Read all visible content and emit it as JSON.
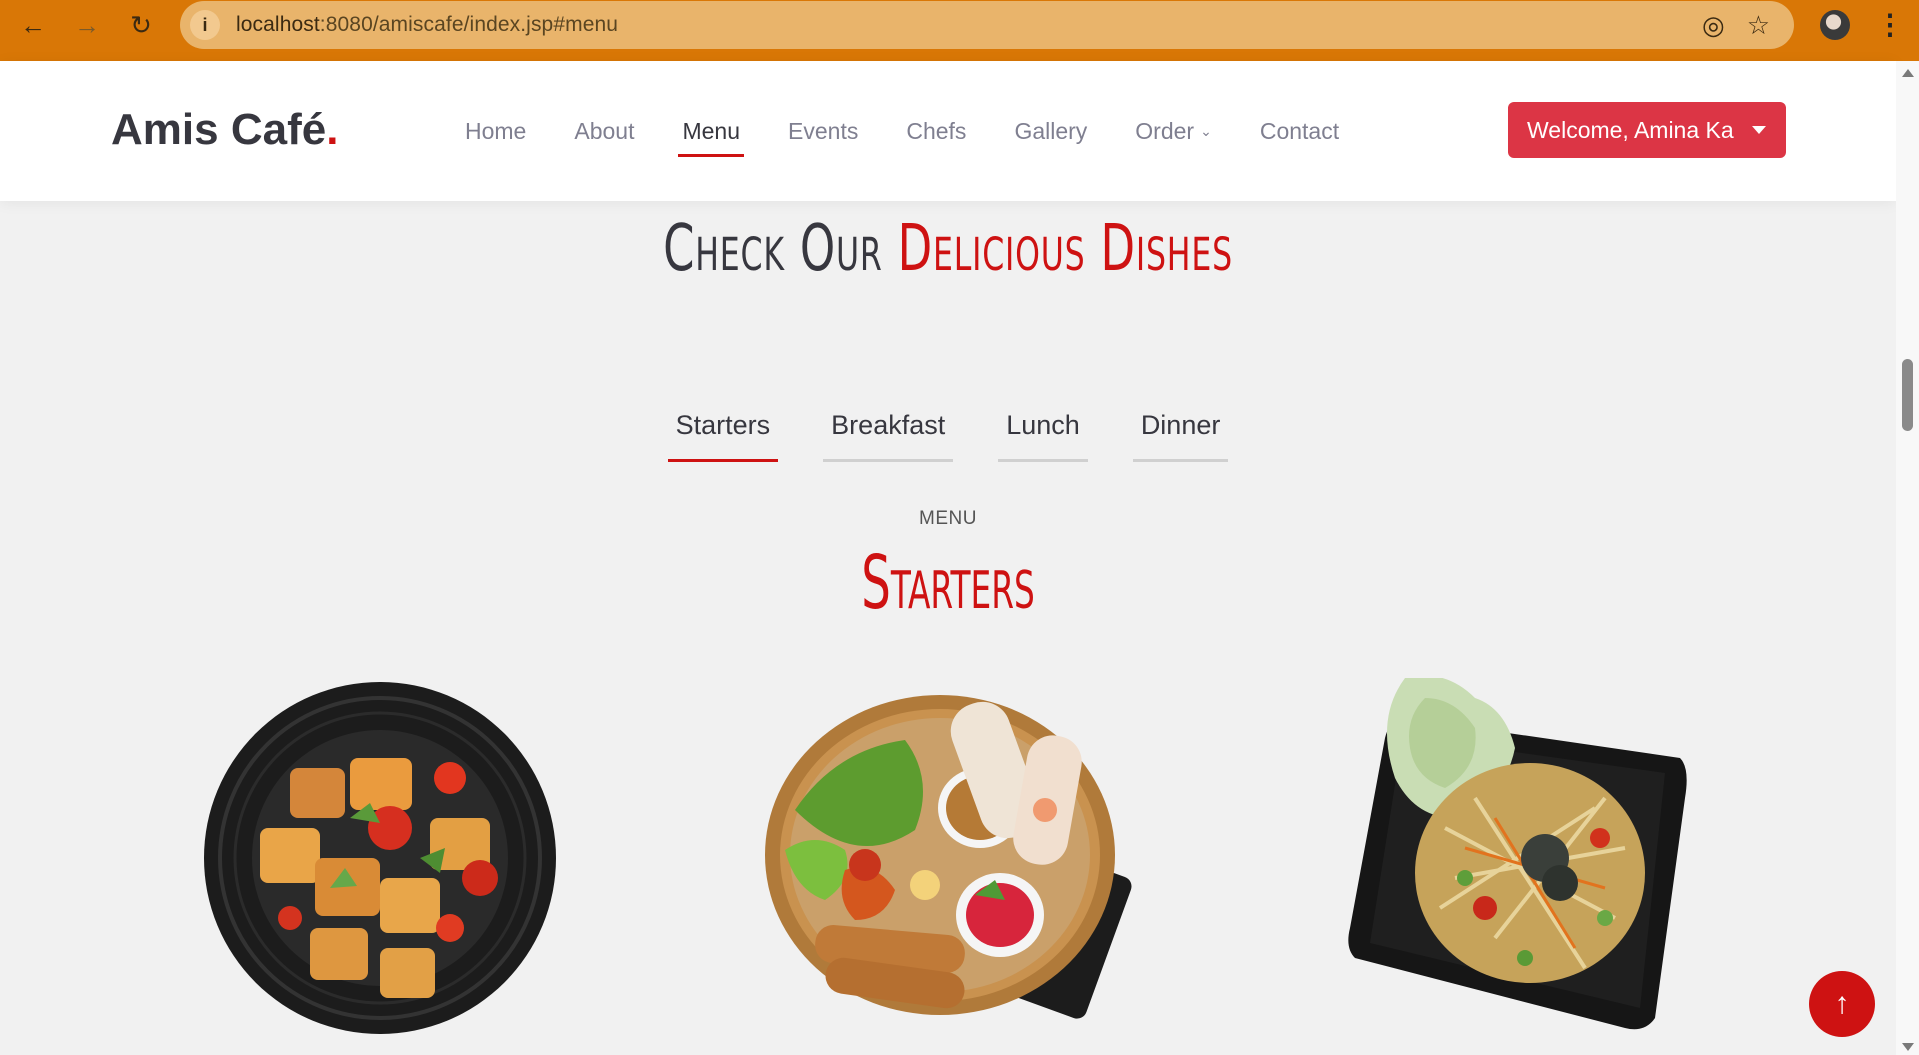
{
  "browser": {
    "url_host": "localhost",
    "url_rest": ":8080/amiscafe/index.jsp#menu",
    "back_icon": "arrow-left-icon",
    "forward_icon": "arrow-right-icon",
    "reload_icon": "reload-icon"
  },
  "header": {
    "logo_text": "Amis Café",
    "logo_dot": ".",
    "nav": [
      {
        "label": "Home"
      },
      {
        "label": "About"
      },
      {
        "label": "Menu"
      },
      {
        "label": "Events"
      },
      {
        "label": "Chefs"
      },
      {
        "label": "Gallery"
      },
      {
        "label": "Order"
      },
      {
        "label": "Contact"
      }
    ],
    "active_nav": "Menu",
    "welcome_label": "Welcome, Amina Ka"
  },
  "menu_section": {
    "headline_part1": "Check Our",
    "headline_part2": "Delicious Dishes",
    "tabs": [
      "Starters",
      "Breakfast",
      "Lunch",
      "Dinner"
    ],
    "active_tab": "Starters",
    "label": "MENU",
    "title": "Starters"
  },
  "colors": {
    "accent": "#ce1212",
    "button": "#dc3545",
    "browser_frame": "#d97706",
    "text_dark": "#37373f"
  }
}
